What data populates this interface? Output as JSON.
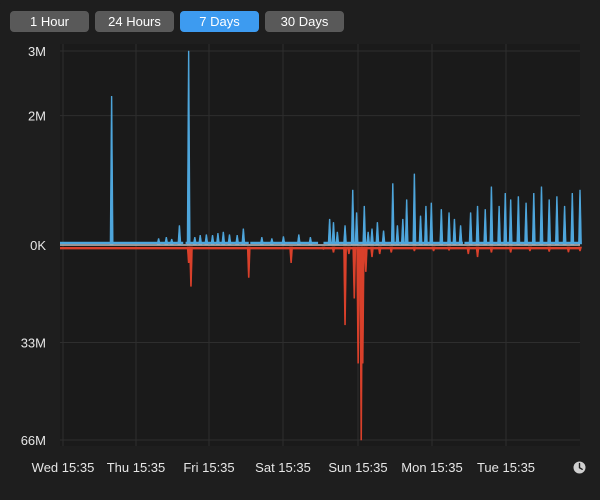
{
  "toolbar": {
    "buttons": [
      {
        "label": "1 Hour",
        "selected": false
      },
      {
        "label": "24 Hours",
        "selected": false
      },
      {
        "label": "7 Days",
        "selected": true
      },
      {
        "label": "30 Days",
        "selected": false
      }
    ]
  },
  "footer": {
    "clock_icon": "clock-icon"
  },
  "colors": {
    "background": "#1e1e1e",
    "button": "#595959",
    "button_selected": "#3d9bf0",
    "upper_series": "#4ea6dc",
    "lower_series": "#d9402b",
    "grid": "#2e2e2e",
    "baseline": "#bfbfbf"
  },
  "chart_data": {
    "type": "area",
    "title": "",
    "xlabel": "",
    "ylabel": "",
    "grid": true,
    "legend": "none",
    "x_ticks": [
      "Wed 15:35",
      "Thu 15:35",
      "Fri 15:35",
      "Sat 15:35",
      "Sun 15:35",
      "Mon 15:35",
      "Tue 15:35"
    ],
    "upper_axis": {
      "ticks": [
        "3M",
        "2M",
        "0K"
      ],
      "tick_values": [
        3000000,
        2000000,
        0
      ],
      "ylim": [
        0,
        3000000
      ]
    },
    "lower_axis": {
      "ticks": [
        "33M",
        "66M"
      ],
      "tick_values": [
        33000000,
        66000000
      ],
      "ylim": [
        0,
        66000000
      ]
    },
    "x_unit": "days since Wed 15:35",
    "series": [
      {
        "name": "",
        "side": "upper",
        "baseline": 50000,
        "gaps": [
          [
            1.6,
            1.63
          ],
          [
            2.45,
            2.47
          ],
          [
            3.35,
            3.42
          ],
          [
            5.23,
            5.25
          ]
        ],
        "points": [
          [
            0.67,
            2300000
          ],
          [
            1.28,
            100000
          ],
          [
            1.38,
            120000
          ],
          [
            1.45,
            90000
          ],
          [
            1.55,
            300000
          ],
          [
            1.67,
            3000000
          ],
          [
            1.75,
            120000
          ],
          [
            1.82,
            150000
          ],
          [
            1.9,
            160000
          ],
          [
            1.98,
            150000
          ],
          [
            2.05,
            180000
          ],
          [
            2.12,
            200000
          ],
          [
            2.2,
            160000
          ],
          [
            2.3,
            150000
          ],
          [
            2.38,
            250000
          ],
          [
            2.62,
            120000
          ],
          [
            2.75,
            100000
          ],
          [
            2.9,
            130000
          ],
          [
            3.1,
            160000
          ],
          [
            3.25,
            120000
          ],
          [
            3.5,
            400000
          ],
          [
            3.55,
            350000
          ],
          [
            3.6,
            200000
          ],
          [
            3.7,
            300000
          ],
          [
            3.8,
            850000
          ],
          [
            3.85,
            500000
          ],
          [
            3.95,
            600000
          ],
          [
            4.0,
            200000
          ],
          [
            4.05,
            250000
          ],
          [
            4.12,
            350000
          ],
          [
            4.2,
            220000
          ],
          [
            4.32,
            950000
          ],
          [
            4.38,
            300000
          ],
          [
            4.45,
            400000
          ],
          [
            4.5,
            700000
          ],
          [
            4.6,
            1100000
          ],
          [
            4.68,
            450000
          ],
          [
            4.75,
            600000
          ],
          [
            4.82,
            650000
          ],
          [
            4.95,
            550000
          ],
          [
            5.05,
            500000
          ],
          [
            5.12,
            400000
          ],
          [
            5.2,
            300000
          ],
          [
            5.33,
            500000
          ],
          [
            5.42,
            600000
          ],
          [
            5.52,
            550000
          ],
          [
            5.6,
            900000
          ],
          [
            5.7,
            600000
          ],
          [
            5.78,
            800000
          ],
          [
            5.85,
            700000
          ],
          [
            5.95,
            750000
          ],
          [
            6.05,
            650000
          ],
          [
            6.15,
            800000
          ],
          [
            6.25,
            900000
          ],
          [
            6.35,
            700000
          ],
          [
            6.45,
            750000
          ],
          [
            6.55,
            600000
          ],
          [
            6.65,
            800000
          ],
          [
            6.75,
            850000
          ]
        ]
      },
      {
        "name": "",
        "side": "lower",
        "baseline": 800000,
        "gaps": [],
        "points": [
          [
            1.67,
            6000000
          ],
          [
            1.7,
            14000000
          ],
          [
            2.45,
            11000000
          ],
          [
            3.0,
            6000000
          ],
          [
            3.42,
            1500000
          ],
          [
            3.55,
            2500000
          ],
          [
            3.7,
            27000000
          ],
          [
            3.75,
            3000000
          ],
          [
            3.82,
            18000000
          ],
          [
            3.87,
            40000000
          ],
          [
            3.91,
            66000000
          ],
          [
            3.93,
            40000000
          ],
          [
            3.97,
            9000000
          ],
          [
            4.05,
            4000000
          ],
          [
            4.15,
            3000000
          ],
          [
            4.3,
            2500000
          ],
          [
            4.6,
            2000000
          ],
          [
            4.85,
            2000000
          ],
          [
            5.05,
            1800000
          ],
          [
            5.3,
            3000000
          ],
          [
            5.42,
            4000000
          ],
          [
            5.6,
            2500000
          ],
          [
            5.85,
            2500000
          ],
          [
            6.1,
            2000000
          ],
          [
            6.35,
            2200000
          ],
          [
            6.6,
            2400000
          ],
          [
            6.75,
            2000000
          ]
        ]
      }
    ]
  }
}
